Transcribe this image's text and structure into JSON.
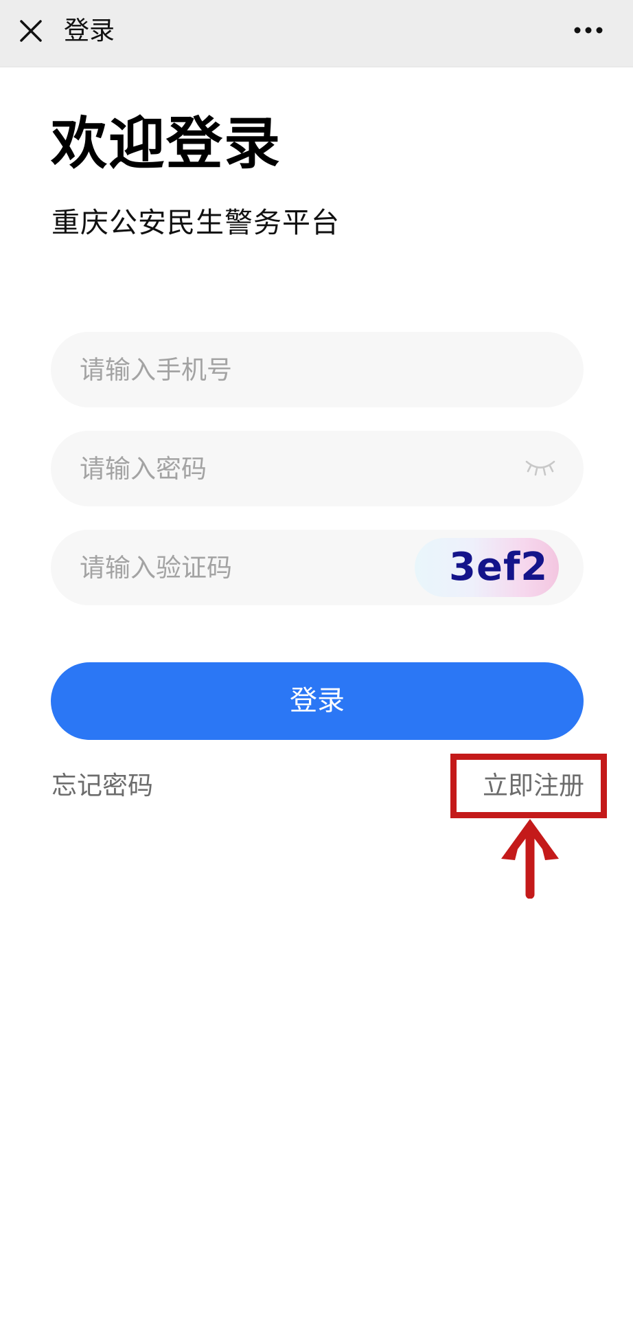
{
  "navbar": {
    "title": "登录",
    "close_icon": "close-icon",
    "more_icon": "more-dots-icon"
  },
  "header": {
    "welcome": "欢迎登录",
    "subtitle": "重庆公安民生警务平台"
  },
  "form": {
    "phone_placeholder": "请输入手机号",
    "password_placeholder": "请输入密码",
    "password_icon": "eye-closed-icon",
    "captcha_placeholder": "请输入验证码",
    "captcha_code": "3ef2"
  },
  "actions": {
    "login_label": "登录",
    "forgot_label": "忘记密码",
    "register_label": "立即注册"
  },
  "colors": {
    "primary": "#2b77f5",
    "navbar_bg": "#ededed",
    "field_bg": "#f7f7f7",
    "annotation_red": "#c41a1a"
  }
}
